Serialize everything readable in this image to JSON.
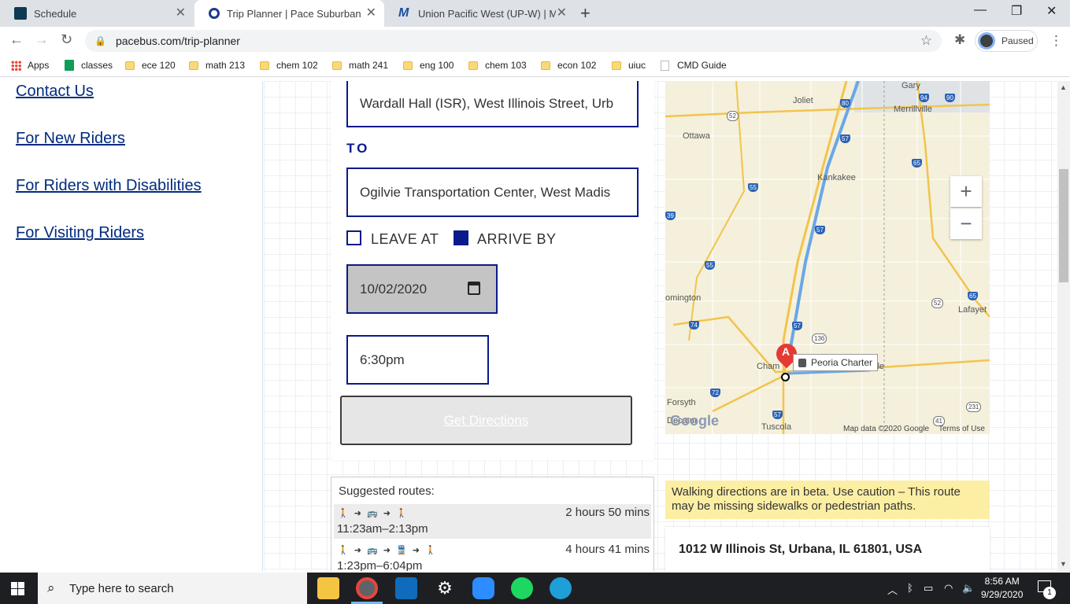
{
  "browser": {
    "tabs": [
      {
        "title": "Schedule",
        "icon": "schedule-favicon"
      },
      {
        "title": "Trip Planner | Pace Suburban Bus",
        "icon": "pace-favicon"
      },
      {
        "title": "Union Pacific West (UP-W) | Metr",
        "icon": "metra-favicon"
      }
    ],
    "url": "pacebus.com/trip-planner",
    "profile_status": "Paused",
    "bookmarks": [
      "Apps",
      "classes",
      "ece 120",
      "math 213",
      "chem 102",
      "math 241",
      "eng 100",
      "chem 103",
      "econ 102",
      "uiuc",
      "CMD Guide"
    ]
  },
  "sidebar": {
    "links": [
      "Contact Us",
      "For New Riders",
      "For Riders with Disabilities",
      "For Visiting Riders"
    ]
  },
  "form": {
    "from_value": "Wardall Hall (ISR), West Illinois Street, Urb",
    "to_label": "TO",
    "to_value": "Ogilvie Transportation Center, West Madis",
    "leave_at_label": "LEAVE AT",
    "leave_at_checked": false,
    "arrive_by_label": "ARRIVE BY",
    "arrive_by_checked": true,
    "date_value": "10/02/2020",
    "time_value": "6:30pm",
    "get_directions_label": "Get Directions"
  },
  "map": {
    "cities": [
      "Joliet",
      "Gary",
      "Merrillville",
      "Ottawa",
      "Kankakee",
      "omington",
      "Lafayet",
      "Cham",
      "Forsyth",
      "Decatur",
      "Tuscola",
      "lle"
    ],
    "highways": [
      "52",
      "80",
      "94",
      "90",
      "57",
      "65",
      "55",
      "39",
      "57",
      "55",
      "52",
      "65",
      "74",
      "57",
      "136",
      "72",
      "57",
      "231",
      "41"
    ],
    "marker_label": "A",
    "tooltip": "Peoria Charter",
    "zoom_in": "+",
    "zoom_out": "−",
    "logo": "Google",
    "attribution": "Map data ©2020 Google",
    "terms": "Terms of Use"
  },
  "routes": {
    "title": "Suggested routes:",
    "items": [
      {
        "icons": "🚶 ➜ 🚌 ➜ 🚶",
        "duration": "2 hours 50 mins",
        "times": "11:23am–2:13pm",
        "selected": true
      },
      {
        "icons": "🚶 ➜ 🚌 ➜ 🚆 ➜ 🚶",
        "duration": "4 hours 41 mins",
        "times": "1:23pm–6:04pm",
        "selected": false
      }
    ]
  },
  "beta_notice": "Walking directions are in beta. Use caution – This route may be missing sidewalks or pedestrian paths.",
  "directions": {
    "start_address": "1012 W Illinois St, Urbana, IL 61801, USA"
  },
  "taskbar": {
    "search_placeholder": "Type here to search",
    "time": "8:56 AM",
    "date": "9/29/2020",
    "notifications": "1"
  }
}
